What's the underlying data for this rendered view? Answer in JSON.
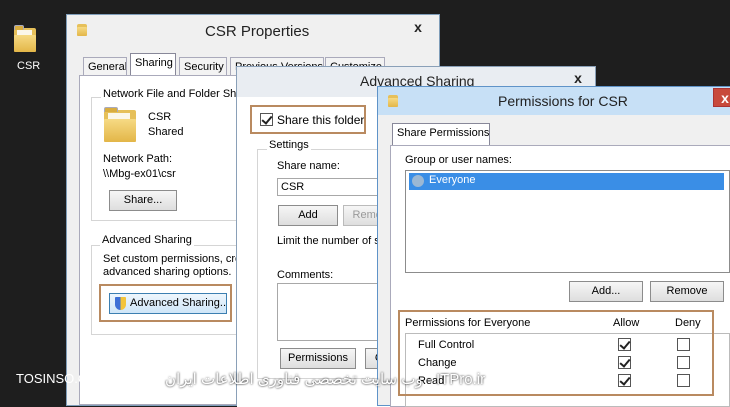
{
  "desktop": {
    "icon_label": "CSR"
  },
  "csr_properties": {
    "title": "CSR Properties",
    "close": "x",
    "tabs": [
      "General",
      "Sharing",
      "Security",
      "Previous Versions",
      "Customize"
    ],
    "nffs_label": "Network File and Folder Sharing",
    "folder_name": "CSR",
    "folder_state": "Shared",
    "network_path_label": "Network Path:",
    "network_path": "\\\\Mbg-ex01\\csr",
    "share_btn": "Share...",
    "adv_group_label": "Advanced Sharing",
    "adv_desc_1": "Set custom permissions, create multiple shares, and set other",
    "adv_desc_2": "advanced sharing options.",
    "adv_btn": "Advanced Sharing..."
  },
  "advanced_sharing": {
    "title": "Advanced Sharing",
    "close": "x",
    "share_checkbox": "Share this folder",
    "settings_label": "Settings",
    "share_name_label": "Share name:",
    "share_name_value": "CSR",
    "add_btn": "Add",
    "remove_btn": "Remove",
    "limit_label": "Limit the number of simultaneous users to:",
    "comments_label": "Comments:",
    "permissions_btn": "Permissions",
    "caching_btn": "Caching"
  },
  "permissions": {
    "title": "Permissions for CSR",
    "close": "x",
    "tab": "Share Permissions",
    "group_label": "Group or user names:",
    "users": [
      "Everyone"
    ],
    "add_btn": "Add...",
    "remove_btn": "Remove",
    "perm_header": "Permissions for Everyone",
    "allow": "Allow",
    "deny": "Deny",
    "rows": [
      {
        "name": "Full Control",
        "allow": true,
        "deny": false
      },
      {
        "name": "Change",
        "allow": true,
        "deny": false
      },
      {
        "name": "Read",
        "allow": true,
        "deny": false
      }
    ]
  },
  "watermark": {
    "left": "TOSINSO.COM",
    "right": "وب سایت تخصصی فناوری اطلاعات ایران - ITPro.ir"
  }
}
